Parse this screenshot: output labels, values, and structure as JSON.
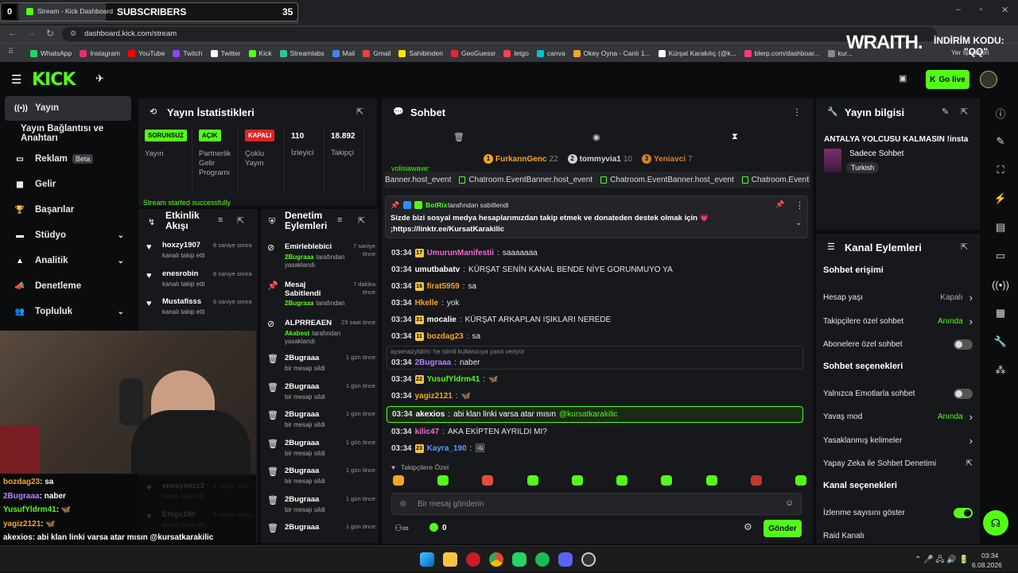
{
  "browser": {
    "tab_title": "Stream - Kick Dashboard",
    "url": "dashboard.kick.com/stream",
    "bookmarks": [
      {
        "label": "WhatsApp",
        "color": "#25d366"
      },
      {
        "label": "Instagram",
        "color": "#e1306c"
      },
      {
        "label": "YouTube",
        "color": "#ff0000"
      },
      {
        "label": "Twitch",
        "color": "#9146ff"
      },
      {
        "label": "Twitter",
        "color": "#ffffff"
      },
      {
        "label": "Kick",
        "color": "#53fc18"
      },
      {
        "label": "Streamlabs",
        "color": "#31c3a2"
      },
      {
        "label": "Mail",
        "color": "#4285f4"
      },
      {
        "label": "Gmail",
        "color": "#ea4335"
      },
      {
        "label": "Sahibinden",
        "color": "#ffe800"
      },
      {
        "label": "GeoGuessr",
        "color": "#e23"
      },
      {
        "label": "letgo",
        "color": "#ff3f55"
      },
      {
        "label": "canva",
        "color": "#00c4cc"
      },
      {
        "label": "Okey Oyna - Canlı 1...",
        "color": "#f5a623"
      },
      {
        "label": "Kürşat Karakılıç (@k...",
        "color": "#fff"
      },
      {
        "label": "blerp.com/dashboar...",
        "color": "#ff3b7f"
      },
      {
        "label": "kur...",
        "color": "#888"
      }
    ],
    "bookmarks_end": "Yer İşaretleri"
  },
  "overlay": {
    "sub_label": "SUBSCRIBERS",
    "sub_count": "35",
    "left_num": "0",
    "brand": "WRAITH.",
    "promo": "İNDİRİM KODU:",
    "promo_code": "\"QQ\""
  },
  "header": {
    "golive": "Go live",
    "golive_prefix": "K"
  },
  "sidebar": {
    "items": [
      {
        "label": "Yayın",
        "icon": "broadcast-icon"
      },
      {
        "label": "Yayın Bağlantısı ve Anahtarı",
        "icon": ""
      },
      {
        "label": "Reklam",
        "icon": "tv-icon",
        "badge": "Beta"
      },
      {
        "label": "Gelir",
        "icon": "grid-icon"
      },
      {
        "label": "Başarılar",
        "icon": "trophy-icon"
      },
      {
        "label": "Stüdyo",
        "icon": "studio-icon"
      },
      {
        "label": "Analitik",
        "icon": "chart-icon"
      },
      {
        "label": "Denetleme",
        "icon": "megaphone-icon"
      },
      {
        "label": "Topluluk",
        "icon": "people-icon"
      }
    ]
  },
  "stats": {
    "title": "Yayın İstatistikleri",
    "cols": [
      {
        "badge": "SORUNSUZ",
        "label": "Yayın",
        "badge_color": "#53fc18"
      },
      {
        "badge": "AÇIK",
        "label": "Partnerlik Gelir Programı",
        "badge_color": "#53fc18"
      },
      {
        "badge": "KAPALI",
        "label": "Çoklu Yayın",
        "badge_color": "#e02424"
      },
      {
        "value": "110",
        "label": "İzleyici"
      },
      {
        "value": "18.892",
        "label": "Takipçi"
      }
    ],
    "status": "Stream started successfully"
  },
  "activity": {
    "title": "Etkinlik Akışı",
    "rows": [
      {
        "user": "hoxzy1907",
        "time": "8 saniye sonra",
        "action": "kanalı takip etti"
      },
      {
        "user": "enesrobin",
        "time": "8 saniye sonra",
        "action": "kanalı takip etti"
      },
      {
        "user": "Mustafisss",
        "time": "6 saniye sonra",
        "action": "kanalı takip etti"
      },
      {
        "user": "enesylmzz3",
        "time": "2 saniye önce",
        "action": "kanalı takip etti"
      },
      {
        "user": "Efegs190",
        "time": "8 saniye sonra",
        "action": "kanalı takip etti"
      }
    ]
  },
  "modlog": {
    "title": "Denetim Eylemleri",
    "rows": [
      {
        "title": "Emirleblebici",
        "time": "7 saniye önce",
        "who": "2Bugraaa",
        "tail": "tarafından yasaklandı",
        "icon": "ban-icon"
      },
      {
        "title": "Mesaj Sabitlendi",
        "time": "7 dakika önce",
        "who": "2Bugraaa",
        "tail": "tarafından",
        "icon": "pin-icon"
      },
      {
        "title": "ALPRREAEN",
        "time": "23 saat önce",
        "who": "Akabest",
        "tail": "tarafından yasaklandı",
        "icon": "ban-icon"
      },
      {
        "title": "2Bugraaa",
        "time": "1 gün önce",
        "who": "",
        "tail": "bir mesajı sildi",
        "icon": "trash-icon"
      },
      {
        "title": "2Bugraaa",
        "time": "1 gün önce",
        "who": "",
        "tail": "bir mesajı sildi",
        "icon": "trash-icon"
      },
      {
        "title": "2Bugraaa",
        "time": "1 gün önce",
        "who": "",
        "tail": "bir mesajı sildi",
        "icon": "trash-icon"
      },
      {
        "title": "2Bugraaa",
        "time": "1 gün önce",
        "who": "",
        "tail": "bir mesajı sildi",
        "icon": "trash-icon"
      },
      {
        "title": "2Bugraaa",
        "time": "1 gün önce",
        "who": "",
        "tail": "bir mesajı sildi",
        "icon": "trash-icon"
      },
      {
        "title": "2Bugraaa",
        "time": "1 gün önce",
        "who": "",
        "tail": "bir mesajı sildi",
        "icon": "trash-icon"
      },
      {
        "title": "2Bugraaa",
        "time": "1 gün önce",
        "who": "",
        "tail": "",
        "icon": "trash-icon"
      }
    ]
  },
  "chat": {
    "title": "Sohbet",
    "top_gifters": [
      {
        "rank": "1",
        "name": "FurkannGenc",
        "count": "22",
        "color": "#f5a623"
      },
      {
        "rank": "2",
        "name": "tommyvia1",
        "count": "10",
        "color": "#cfd3d6"
      },
      {
        "rank": "3",
        "name": "Yeniavci",
        "count": "7",
        "color": "#d9822b"
      }
    ],
    "partial_line": "volisiawave:",
    "ticker": [
      "Banner.host_event",
      "Chatroom.EventBanner.host_event",
      "Chatroom.EventBanner.host_event",
      "Chatroom.EventBanner.host_event",
      "Chatroom.Eve"
    ],
    "pinned": {
      "by": "BotRix",
      "by_tail": "tarafından sabitlendi",
      "text": "Sizde bizi sosyal medya hesaplarımızdan takip etmek ve donateden destek olmak için 💗",
      "link": ";https://linktr.ee/KursatKarakilic"
    },
    "messages": [
      {
        "time": "03:34",
        "badge": "17",
        "user": "UmurunManifestii",
        "color": "#f06ad0",
        "text": "saaaaaaa"
      },
      {
        "time": "03:34",
        "badge": "",
        "user": "umutbabatv",
        "color": "#ffffff",
        "text": "KÜRŞAT SENİN KANAL BENDE NİYE GORUNMUYO YA"
      },
      {
        "time": "03:34",
        "badge": "16",
        "user": "firat5959",
        "color": "#f5a623",
        "text": "sa"
      },
      {
        "time": "03:34",
        "badge": "",
        "user": "Hkelle",
        "color": "#f5a623",
        "text": "yok"
      },
      {
        "time": "03:34",
        "badge": "31",
        "user": "mocalie",
        "color": "#ffffff",
        "text": "KÜRŞAT ARKAPLAN IŞIKLARI NEREDE"
      },
      {
        "time": "03:34",
        "badge": "11",
        "user": "bozdag23",
        "color": "#f5a623",
        "text": "sa"
      }
    ],
    "reply_hint": "aysenazyldrm: he isimli kullanıcıya yanıt veriyor",
    "messages2": [
      {
        "time": "03:34",
        "badge": "",
        "user": "2Bugraaa",
        "color": "#b980ff",
        "text": "naber"
      },
      {
        "time": "03:34",
        "badge": "22",
        "user": "YusufYldrm41",
        "color": "#53fc18",
        "text": "🦋"
      },
      {
        "time": "03:34",
        "badge": "",
        "user": "yagiz2121",
        "color": "#f5a623",
        "text": "🦋"
      }
    ],
    "highlight": {
      "time": "03:34",
      "user": "akexios",
      "text": "abi klan linki varsa atar mısın",
      "mention": "@kursatkarakilic"
    },
    "messages3": [
      {
        "time": "03:34",
        "badge": "",
        "user": "kilic47",
        "color": "#f06ad0",
        "text": "AKA EKİPTEN AYRILDI MI?"
      },
      {
        "time": "03:34",
        "badge": "23",
        "user": "Kayra_190",
        "color": "#5b9bff",
        "text": "🖼"
      }
    ],
    "followers_only": "Takipçilere Özel",
    "emotes": [
      "emote-1",
      "emote-2",
      "emote-3",
      "emote-4",
      "emote-5",
      "emote-6",
      "emote-7",
      "emote-8",
      "emote-9",
      "emote-10"
    ],
    "input_placeholder": "Bir mesaj gönderin",
    "points": "0",
    "send": "Gönder"
  },
  "streaminfo": {
    "title": "Yayın bilgisi",
    "stream_title": "ANTALYA YOLCUSU KALMASIN !insta",
    "category": "Sadece Sohbet",
    "tag": "Turkish"
  },
  "channel_actions": {
    "title": "Kanal Eylemleri",
    "section1": "Sohbet erişimi",
    "rows1": [
      {
        "label": "Hesap yaşı",
        "value": "Kapalı",
        "type": "link"
      },
      {
        "label": "Takipçilere özel sohbet",
        "value": "Anında",
        "type": "link-green"
      },
      {
        "label": "Abonelere özel sohbet",
        "value": "",
        "type": "toggle-off"
      }
    ],
    "section2": "Sohbet seçenekleri",
    "rows2": [
      {
        "label": "Yalnızca Emotlarla sohbet",
        "value": "",
        "type": "toggle-off"
      },
      {
        "label": "Yavaş mod",
        "value": "Anında",
        "type": "link-green"
      },
      {
        "label": "Yasaklanmış kelimeler",
        "value": "",
        "type": "link"
      },
      {
        "label": "Yapay Zeka ile Sohbet Denetimi",
        "value": "",
        "type": "external"
      }
    ],
    "section3": "Kanal seçenekleri",
    "rows3": [
      {
        "label": "İzlenme sayısını göster",
        "value": "",
        "type": "toggle-on"
      },
      {
        "label": "Raid Kanalı",
        "value": "",
        "type": "none"
      }
    ]
  },
  "overlay_chat": [
    {
      "user": "bozdag23",
      "text": ": sa",
      "color": "#f5a623"
    },
    {
      "user": "2Bugraaa",
      "text": ": naber",
      "color": "#b980ff"
    },
    {
      "user": "YusufYldrm41",
      "text": ": 🦋",
      "color": "#53fc18"
    },
    {
      "user": "yagiz2121",
      "text": ": 🦋",
      "color": "#f5a623"
    },
    {
      "user": "akexios",
      "text": ": abi klan linki varsa atar mısın @kursatkarakilic",
      "color": "#ffffff"
    },
    {
      "user": "kilic47",
      "text": ": AKA EKİPTEN AYRILDI MI?",
      "color": "#f06ad0"
    },
    {
      "user": "Kayra_190",
      "text": ": 🖼",
      "color": "#5b9bff"
    }
  ],
  "taskbar": {
    "time": "03:34",
    "date": "6.08.2026"
  }
}
